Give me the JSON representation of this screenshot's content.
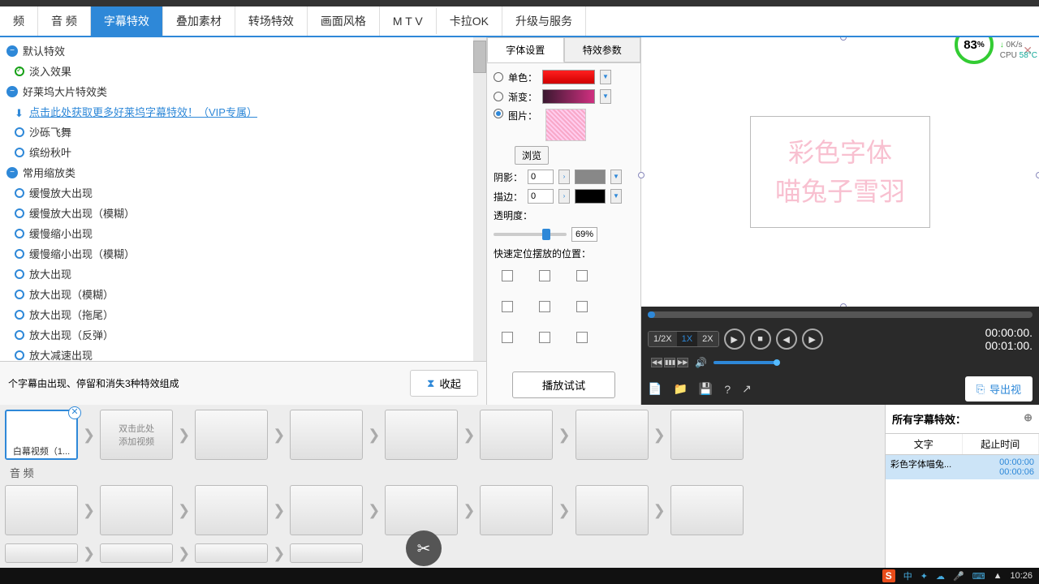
{
  "toolbar": {
    "tabs": [
      "频",
      "音 频",
      "字幕特效",
      "叠加素材",
      "转场特效",
      "画面风格",
      "M T V",
      "卡拉OK",
      "升级与服务"
    ],
    "active_index": 2
  },
  "effects": {
    "categories": [
      {
        "label": "默认特效",
        "items": [
          {
            "label": "淡入效果",
            "checked": true
          }
        ]
      },
      {
        "label": "好莱坞大片特效类",
        "items": [
          {
            "label": "点击此处获取更多好莱坞字幕特效！（VIP专属）",
            "link": true
          },
          {
            "label": "沙砾飞舞"
          },
          {
            "label": "缤纷秋叶"
          }
        ]
      },
      {
        "label": "常用缩放类",
        "items": [
          {
            "label": "缓慢放大出现"
          },
          {
            "label": "缓慢放大出现（模糊）"
          },
          {
            "label": "缓慢缩小出现"
          },
          {
            "label": "缓慢缩小出现（模糊）"
          },
          {
            "label": "放大出现"
          },
          {
            "label": "放大出现（模糊）"
          },
          {
            "label": "放大出现（拖尾）"
          },
          {
            "label": "放大出现（反弹）"
          },
          {
            "label": "放大减速出现"
          },
          {
            "label": "放大减速出现（模糊）"
          }
        ]
      }
    ],
    "footer_text": "个字幕由出现、停留和消失3种特效组成",
    "collapse_label": "收起"
  },
  "font_panel": {
    "tabs": [
      "字体设置",
      "特效参数"
    ],
    "active_tab": 0,
    "solid_label": "单色：",
    "gradient_label": "渐变：",
    "image_label": "图片：",
    "browse_label": "浏览",
    "shadow_label": "阴影：",
    "shadow_value": "0",
    "stroke_label": "描边：",
    "stroke_value": "0",
    "opacity_label": "透明度：",
    "opacity_value": "69%",
    "position_label": "快速定位摆放的位置：",
    "selected_fill": "image",
    "play_test_label": "播放试试"
  },
  "preview": {
    "text_line1": "彩色字体",
    "text_line2": "喵兔子雪羽"
  },
  "player": {
    "speeds": [
      "1/2X",
      "1X",
      "2X"
    ],
    "active_speed": 1,
    "time_current": "00:00:00.",
    "time_total": "00:01:00.",
    "export_label": "导出视",
    "perf_pct": "83",
    "perf_unit": "%",
    "net_speed": "0K/s",
    "cpu_label": "CPU",
    "cpu_temp": "58°C"
  },
  "timeline": {
    "clip1_label": "白幕视频（1...",
    "add_hint": "双击此处\n添加视频",
    "audio_label": "音 频"
  },
  "subtitles": {
    "header": "所有字幕特效：",
    "col_text": "文字",
    "col_time": "起止时间",
    "row1_text": "彩色字体喵兔...",
    "row1_start": "00:00:00",
    "row1_end": "00:00:06"
  },
  "taskbar": {
    "ime": "S",
    "ime_text": "中",
    "clock": "10:26"
  }
}
